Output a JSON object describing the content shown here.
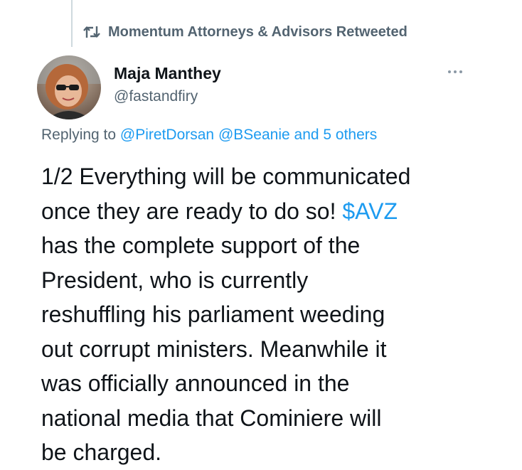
{
  "retweet": {
    "icon": "retweet-icon",
    "text": "Momentum Attorneys & Advisors Retweeted"
  },
  "author": {
    "avatar": "avatar",
    "name": "Maja Manthey",
    "handle": "@fastandfiry"
  },
  "more_icon": "more-icon",
  "replying": {
    "prefix": "Replying to",
    "mentions": [
      "@PiretDorsan",
      "@BSeanie"
    ],
    "and": "and",
    "others": "5 others"
  },
  "tweet": {
    "lines": [
      "1/2 Everything will be communicated",
      "once they are ready to do so!",
      "$AVZ",
      "has the complete support of the",
      "President, who is currently",
      "reshuffling his parliament weeding",
      "out corrupt ministers. Meanwhile it",
      "was officially announced in the",
      "national media that Cominiere will",
      "be charged."
    ]
  },
  "colors": {
    "link": "#1d9bf0",
    "secondary": "#536471",
    "text": "#0f1419"
  }
}
